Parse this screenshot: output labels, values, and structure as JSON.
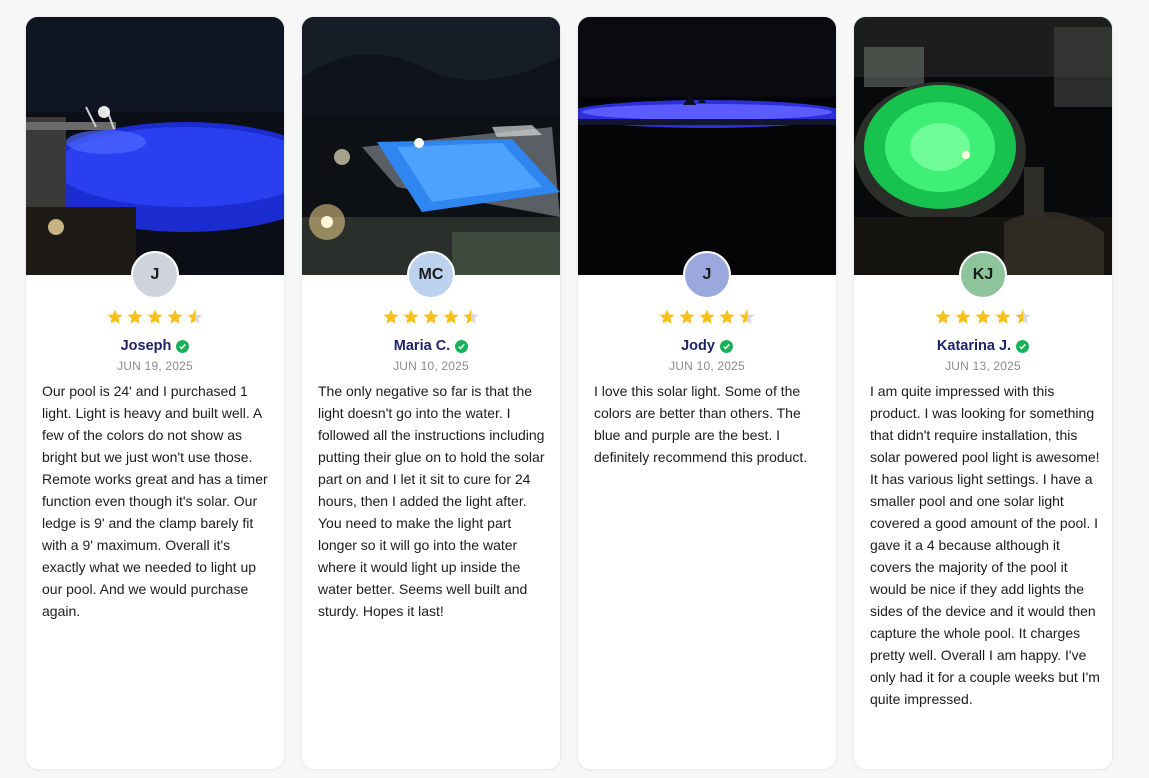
{
  "reviews": [
    {
      "initials": "J",
      "avatar_color": "#cfd3dc",
      "name": "Joseph",
      "date": "JUN 19, 2025",
      "rating": 4.5,
      "text": "Our pool is 24' and I purchased 1 light. Light is heavy and built well. A few of the colors do not show as bright but we just won't use those. Remote works great and has a timer function even though it's solar. Our ledge is 9' and the clamp barely fit with a 9' maximum. Overall it's exactly what we needed to light up our pool. And we would purchase again.",
      "photo": "round-pool-blue"
    },
    {
      "initials": "MC",
      "avatar_color": "#bcd2ee",
      "name": "Maria C.",
      "date": "JUN 10, 2025",
      "rating": 4.5,
      "text": "The only negative so far is that the light doesn't go into the water. I followed all the instructions including putting their glue on to hold the solar part on and I let it sit to cure for 24 hours, then I added the light after. You need to make the light part longer so it will go into the water where it would light up inside the water better. Seems well built and sturdy. Hopes it last!",
      "photo": "rectangular-pool-night"
    },
    {
      "initials": "J",
      "avatar_color": "#9aa8dd",
      "name": "Jody",
      "date": "JUN 10, 2025",
      "rating": 4.5,
      "text": "I love this solar light. Some of the colors are better than others. The blue and purple are the best. I definitely recommend this product.",
      "photo": "pool-edge-glow"
    },
    {
      "initials": "KJ",
      "avatar_color": "#8ec49b",
      "name": "Katarina J.",
      "date": "JUN 13, 2025",
      "rating": 4.5,
      "text": "I am quite impressed with this product. I was looking for something that didn't require installation, this solar powered pool light is awesome! It has various light settings. I have a smaller pool and one solar light covered a good amount of the pool. I gave it a 4 because although it covers the majority of the pool it would be nice if they add lights the sides of the device and it would then capture the whole pool. It charges pretty well. Overall I am happy. I've only had it for a couple weeks but I'm quite impressed.",
      "photo": "round-pool-green"
    }
  ],
  "colors": {
    "star": "#f6c01a",
    "star_empty": "#d8d8d8",
    "name": "#1d2366",
    "verified": "#16b35a"
  }
}
